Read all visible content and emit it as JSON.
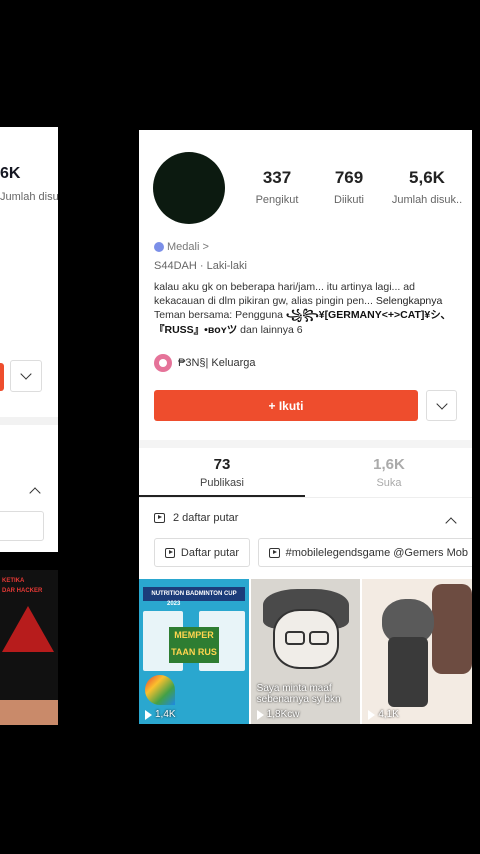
{
  "ghost_card": {
    "stat_value": "6K",
    "stat_label": "Jumlah disuk..",
    "thumb_text": "KETIKA\nDAR HACKER"
  },
  "profile": {
    "stats": [
      {
        "value": "337",
        "label": "Pengikut"
      },
      {
        "value": "769",
        "label": "Diikuti"
      },
      {
        "value": "5,6K",
        "label": "Jumlah disuk.."
      }
    ],
    "medal": "Medali >",
    "username": "S44DAH",
    "gender": "Laki-laki",
    "bio": "kalau aku gk on beberapa hari/jam... itu artinya lagi... ad kekacauan di dlm pikiran gw, alias pingin pen...",
    "bio_more": "Selengkapnya",
    "mutual_prefix": "Teman bersama:  Pengguna",
    "mutual_names": "꧁꧂¥[GERMANY<+>CAT]¥シ、『RUSS』•ʙᴏʏツ",
    "mutual_suffix": "dan lainnya 6",
    "family": "₱3N§| Keluarga",
    "follow_label": "+ Ikuti"
  },
  "tabs": [
    {
      "value": "73",
      "label": "Publikasi"
    },
    {
      "value": "1,6K",
      "label": "Suka"
    }
  ],
  "playlists": {
    "header": "2 daftar putar",
    "chips": [
      "Daftar putar",
      "#mobilelegendsgame @Gemers Mob"
    ]
  },
  "videos": [
    {
      "title": "NUTRITION BADMINTON CUP",
      "year": "2023",
      "banner": "MEMPER TAAN RUS",
      "views": "1,4K"
    },
    {
      "caption": "Saya minta maaf sebenarnya sy bkn",
      "views": "1,8Kcw"
    },
    {
      "views": "4,1K"
    }
  ],
  "colors": {
    "accent": "#ee4d2d",
    "background": "#000000",
    "card": "#ffffff"
  }
}
